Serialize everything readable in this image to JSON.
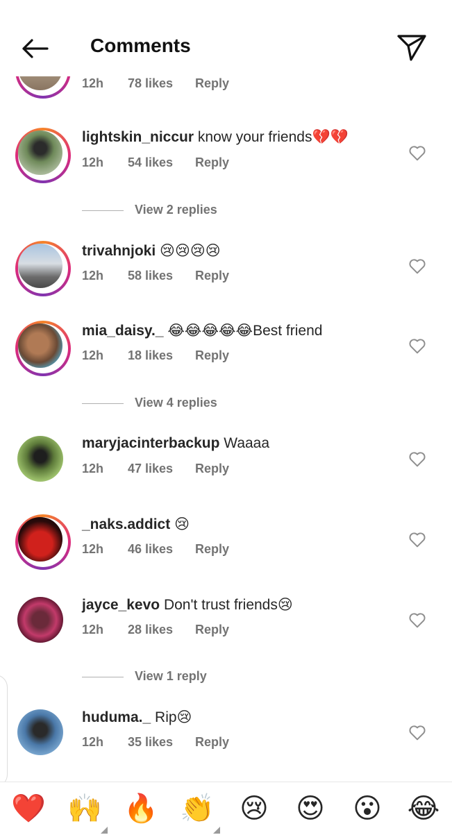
{
  "header": {
    "title": "Comments"
  },
  "partial_comment": {
    "time": "12h",
    "likes": "78 likes",
    "reply": "Reply"
  },
  "comments": [
    {
      "username": "lightskin_niccur",
      "text": "know your friends💔💔",
      "time": "12h",
      "likes": "54 likes",
      "reply": "Reply"
    },
    {
      "username": "trivahnjoki",
      "text": "😢😢😢😢",
      "time": "12h",
      "likes": "58 likes",
      "reply": "Reply"
    },
    {
      "username": "mia_daisy._",
      "text": "😂😂😂😂😂Best friend",
      "time": "12h",
      "likes": "18 likes",
      "reply": "Reply"
    },
    {
      "username": "maryjacinterbackup",
      "text": "Waaaa",
      "time": "12h",
      "likes": "47 likes",
      "reply": "Reply"
    },
    {
      "username": "_naks.addict",
      "text": "😢",
      "time": "12h",
      "likes": "46 likes",
      "reply": "Reply"
    },
    {
      "username": "jayce_kevo",
      "text": "Don't trust friends😢",
      "time": "12h",
      "likes": "28 likes",
      "reply": "Reply"
    },
    {
      "username": "huduma._",
      "text": "Rip😢",
      "time": "12h",
      "likes": "35 likes",
      "reply": "Reply"
    }
  ],
  "view_replies": [
    "View 2 replies",
    "View 4 replies",
    "View 1 reply"
  ],
  "emoji_bar": [
    "❤️",
    "🙌",
    "🔥",
    "👏",
    "😢",
    "😍",
    "😮",
    "😂"
  ],
  "colors": {
    "text": "#262626",
    "secondary": "#737373",
    "story_ring": "#dd2a7b"
  },
  "icons": [
    "back-arrow-icon",
    "send-icon",
    "heart-outline-icon"
  ]
}
